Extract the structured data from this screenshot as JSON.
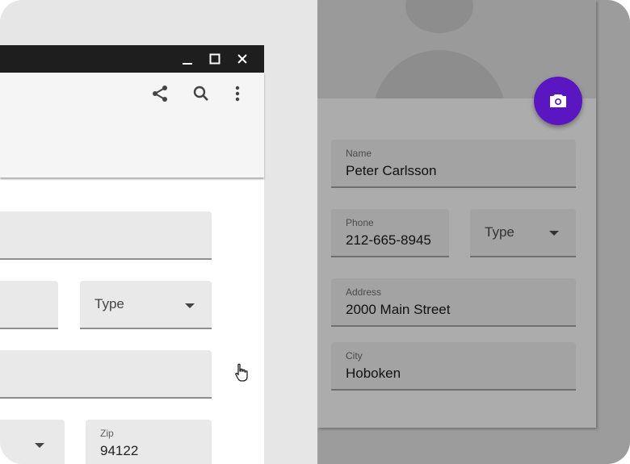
{
  "window": {
    "controls": {
      "minimize": "minimize",
      "maximize": "maximize",
      "close": "close"
    },
    "toolbar_icons": [
      "share-icon",
      "search-icon",
      "more-vert-icon"
    ]
  },
  "left_form": {
    "type_select": {
      "placeholder": "Type"
    },
    "zip": {
      "label": "Zip",
      "value": "94122"
    }
  },
  "contact_card": {
    "name": {
      "label": "Name",
      "value": "Peter Carlsson"
    },
    "phone": {
      "label": "Phone",
      "value": "212-665-8945"
    },
    "type_select": {
      "placeholder": "Type"
    },
    "address": {
      "label": "Address",
      "value": "2000 Main Street"
    },
    "city": {
      "label": "City",
      "value": "Hoboken"
    },
    "fab_icon": "camera-icon"
  },
  "colors": {
    "accent": "#5a16c0",
    "titlebar": "#1e1e1e"
  }
}
